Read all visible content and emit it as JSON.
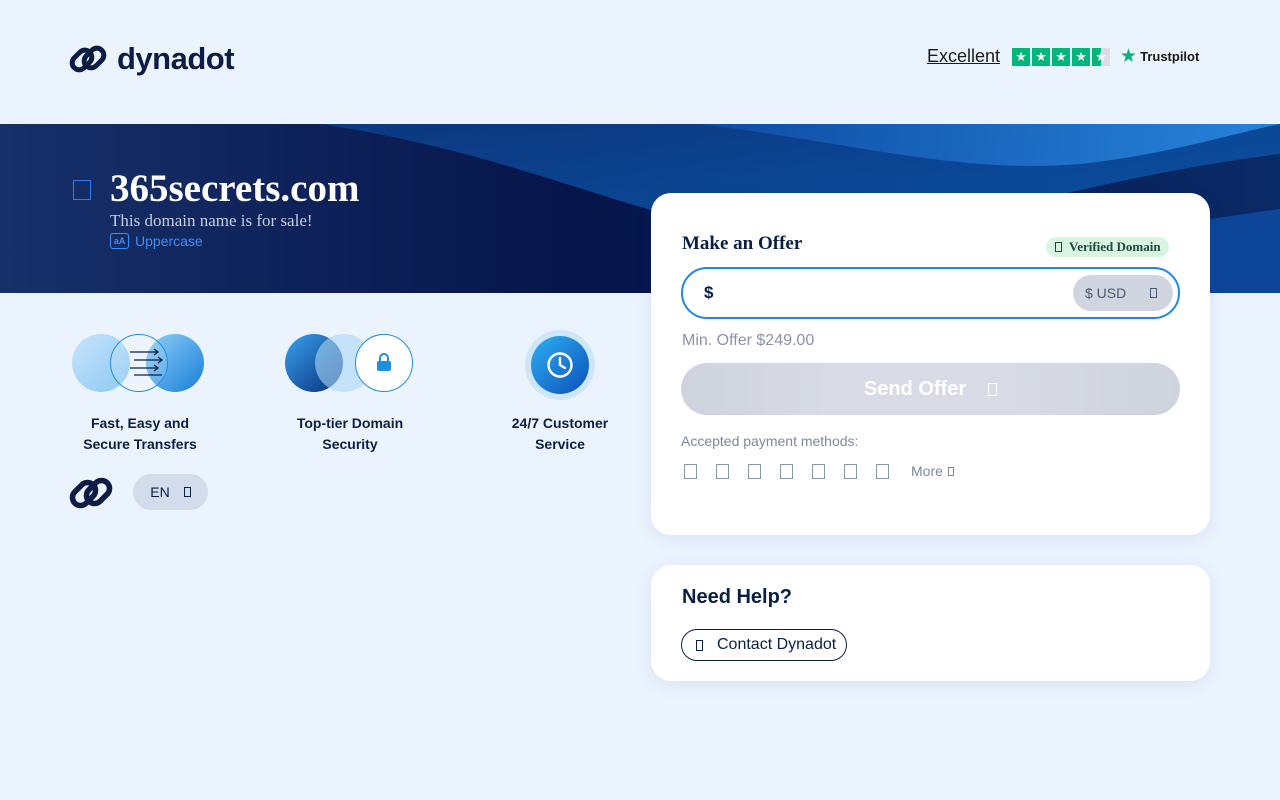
{
  "header": {
    "brand": "dynadot",
    "trustpilot": {
      "rating_word": "Excellent",
      "stars": 4.5,
      "brand": "Trustpilot"
    }
  },
  "banner": {
    "domain": "365secrets.com",
    "subtitle": "This domain name is for sale!",
    "uppercase_label": "Uppercase",
    "uppercase_icon_text": "aA"
  },
  "features": [
    {
      "line1": "Fast, Easy and",
      "line2": "Secure Transfers",
      "icon": "transfer-icon"
    },
    {
      "line1": "Top-tier Domain",
      "line2": "Security",
      "icon": "lock-icon"
    },
    {
      "line1": "24/7 Customer",
      "line2": "Service",
      "icon": "clock-icon"
    }
  ],
  "footer": {
    "language": "EN"
  },
  "offer": {
    "title": "Make an Offer",
    "verified_label": "Verified Domain",
    "currency_symbol": "$",
    "amount_value": "",
    "currency": "$ USD",
    "min_offer": "Min. Offer $249.00",
    "send_label": "Send Offer",
    "payment_label": "Accepted payment methods:",
    "payment_methods": [
      "payment-icon-1",
      "payment-icon-2",
      "payment-icon-3",
      "payment-icon-4",
      "payment-icon-5",
      "payment-icon-6",
      "payment-icon-7"
    ],
    "more_label": "More"
  },
  "help": {
    "title": "Need Help?",
    "contact_label": "Contact Dynadot"
  },
  "colors": {
    "page_bg": "#ebf3fe",
    "navy": "#0a1f44",
    "accent_blue": "#1e88e5",
    "trustpilot_green": "#00b67a",
    "verified_bg": "#d8f5df"
  }
}
